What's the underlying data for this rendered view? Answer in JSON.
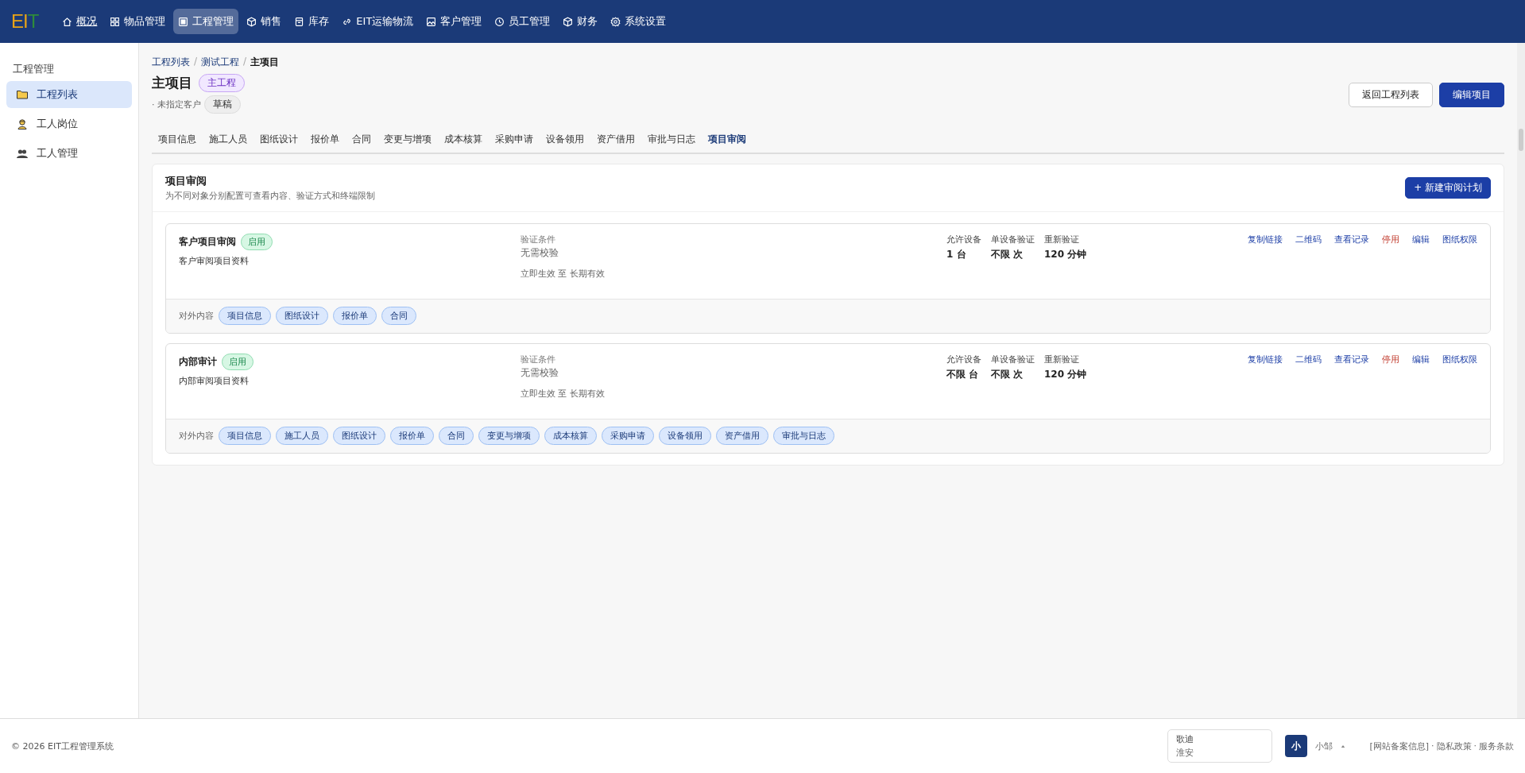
{
  "logo": {
    "letters": [
      "E",
      "I",
      "T"
    ]
  },
  "nav": [
    {
      "label": "概况",
      "selected": false,
      "underlined": true
    },
    {
      "label": "物品管理",
      "selected": false,
      "underlined": false
    },
    {
      "label": "工程管理",
      "selected": true,
      "underlined": false
    },
    {
      "label": "销售",
      "selected": false,
      "underlined": false
    },
    {
      "label": "库存",
      "selected": false,
      "underlined": false
    },
    {
      "label": "EIT运输物流",
      "selected": false,
      "underlined": false
    },
    {
      "label": "客户管理",
      "selected": false,
      "underlined": false
    },
    {
      "label": "员工管理",
      "selected": false,
      "underlined": false
    },
    {
      "label": "财务",
      "selected": false,
      "underlined": false
    },
    {
      "label": "系统设置",
      "selected": false,
      "underlined": false
    }
  ],
  "sidebar": {
    "title": "工程管理",
    "items": [
      {
        "label": "工程列表",
        "selected": true
      },
      {
        "label": "工人岗位",
        "selected": false
      },
      {
        "label": "工人管理",
        "selected": false
      }
    ]
  },
  "breadcrumb_separator": "/",
  "breadcrumb": [
    {
      "label": "工程列表",
      "current": false
    },
    {
      "label": "测试工程",
      "current": false
    },
    {
      "label": "主项目",
      "current": true
    }
  ],
  "project": {
    "title": "主项目",
    "type_badge": "主工程",
    "customer": "· 未指定客户",
    "status_badge": "草稿"
  },
  "header_buttons": [
    {
      "label": "返回工程列表",
      "primary": false
    },
    {
      "label": "编辑项目",
      "primary": true
    }
  ],
  "tabs": [
    {
      "label": "项目信息",
      "selected": false
    },
    {
      "label": "施工人员",
      "selected": false
    },
    {
      "label": "图纸设计",
      "selected": false
    },
    {
      "label": "报价单",
      "selected": false
    },
    {
      "label": "合同",
      "selected": false
    },
    {
      "label": "变更与增项",
      "selected": false
    },
    {
      "label": "成本核算",
      "selected": false
    },
    {
      "label": "采购申请",
      "selected": false
    },
    {
      "label": "设备领用",
      "selected": false
    },
    {
      "label": "资产借用",
      "selected": false
    },
    {
      "label": "审批与日志",
      "selected": false
    },
    {
      "label": "项目审阅",
      "selected": true
    }
  ],
  "panel": {
    "title": "项目审阅",
    "subtitle": "为不同对象分别配置可查看内容、验证方式和终端限制",
    "new_button": "+ 新建审阅计划",
    "plans": [
      {
        "name": "客户项目审阅",
        "status": "启用",
        "enabled": true,
        "description": "客户审阅项目资料",
        "condition_label": "验证条件",
        "condition": "无需校验",
        "validity": "立即生效 至 长期有效",
        "stats": [
          {
            "label": "允许设备",
            "value": "1 台"
          },
          {
            "label": "单设备验证",
            "value": "不限 次"
          },
          {
            "label": "重新验证",
            "value": "120 分钟"
          }
        ],
        "actions": [
          {
            "label": "复制链接",
            "kind": "link"
          },
          {
            "label": "二维码",
            "kind": "link"
          },
          {
            "label": "查看记录",
            "kind": "link"
          },
          {
            "label": "停用",
            "kind": "danger"
          },
          {
            "label": "编辑",
            "kind": "link"
          },
          {
            "label": "图纸权限",
            "kind": "link"
          }
        ],
        "content_label": "对外内容",
        "contents": [
          "项目信息",
          "图纸设计",
          "报价单",
          "合同"
        ]
      },
      {
        "name": "内部审计",
        "status": "启用",
        "enabled": true,
        "description": "内部审阅项目资料",
        "condition_label": "验证条件",
        "condition": "无需校验",
        "validity": "立即生效 至 长期有效",
        "stats": [
          {
            "label": "允许设备",
            "value": "不限 台"
          },
          {
            "label": "单设备验证",
            "value": "不限 次"
          },
          {
            "label": "重新验证",
            "value": "120 分钟"
          }
        ],
        "actions": [
          {
            "label": "复制链接",
            "kind": "link"
          },
          {
            "label": "二维码",
            "kind": "link"
          },
          {
            "label": "查看记录",
            "kind": "link"
          },
          {
            "label": "停用",
            "kind": "danger"
          },
          {
            "label": "编辑",
            "kind": "link"
          },
          {
            "label": "图纸权限",
            "kind": "link"
          }
        ],
        "content_label": "对外内容",
        "contents": [
          "项目信息",
          "施工人员",
          "图纸设计",
          "报价单",
          "合同",
          "变更与增项",
          "成本核算",
          "采购申请",
          "设备领用",
          "资产借用",
          "审批与日志"
        ]
      }
    ]
  },
  "footer": {
    "copyright": "© 2026 EIT工程管理系统",
    "location": {
      "company": "歌迪",
      "city": "淮安"
    },
    "user": {
      "avatar": "小",
      "name": "小邹"
    },
    "link_separator": "·",
    "links": [
      "[网站备案信息]",
      "隐私政策",
      "服务条款"
    ]
  }
}
